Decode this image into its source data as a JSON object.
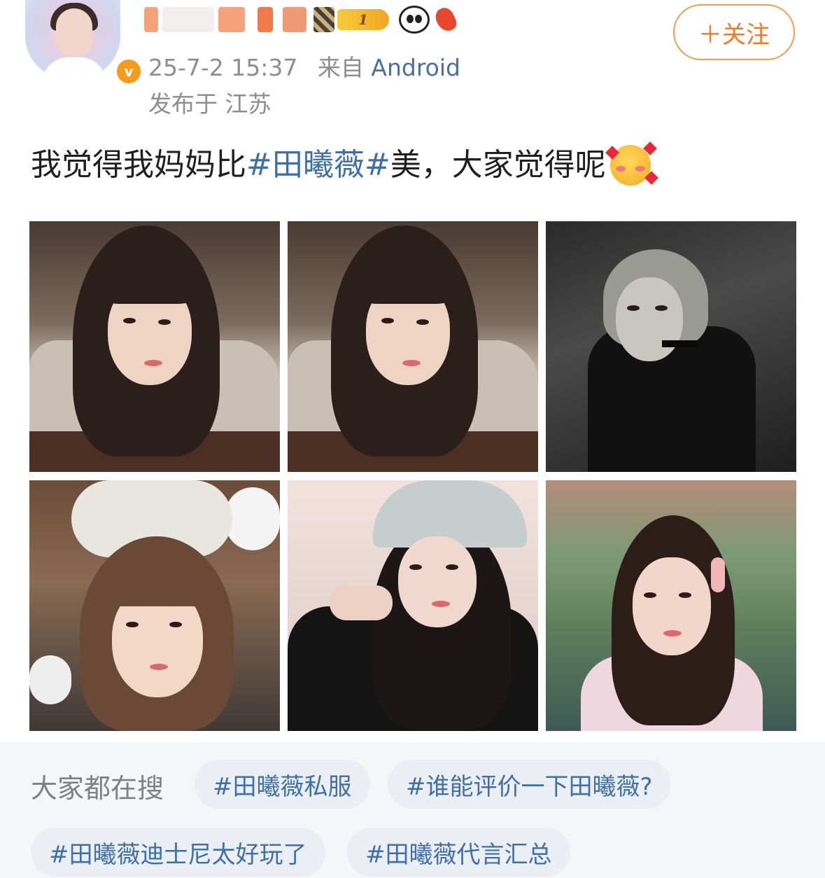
{
  "post": {
    "level": "1",
    "timestamp": "25-7-2 15:37",
    "source_prefix": "来自",
    "source": "Android",
    "location": "发布于 江苏",
    "follow_label": "＋关注",
    "text_before": "我觉得我妈妈比",
    "hashtag": "#田曦薇#",
    "text_after": " 美，大家觉得呢",
    "verified_badge": "v",
    "icons": [
      "avatar",
      "verified-badge-icon",
      "level-badge-icon",
      "panda-icon",
      "koi-icon",
      "blush-emoji-icon"
    ],
    "photo_count": 6
  },
  "search": {
    "label": "大家都在搜",
    "chips": [
      "#田曦薇私服",
      "#谁能评价一下田曦薇?",
      "#田曦薇迪士尼太好玩了",
      "#田曦薇代言汇总"
    ]
  },
  "colors": {
    "link": "#3e6fa8",
    "follow": "#f07a2b",
    "meta": "#8d8d8d",
    "chip_bg": "#ebeef3",
    "verified": "#f79b1d"
  }
}
